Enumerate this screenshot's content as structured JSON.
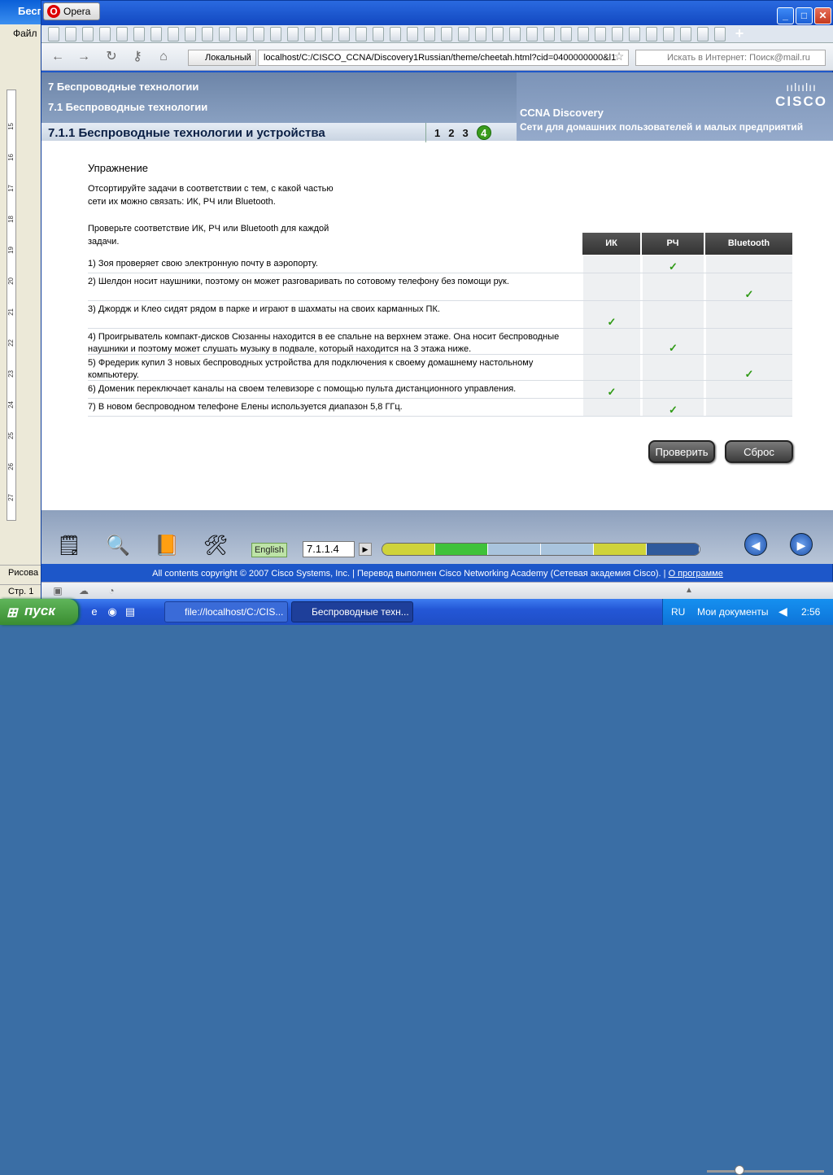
{
  "word": {
    "title": "Бесп",
    "menu_file": "Файл",
    "ruler_marks": [
      "15",
      "16",
      "17",
      "18",
      "19",
      "20",
      "21",
      "22",
      "23",
      "24",
      "25",
      "26",
      "27"
    ],
    "draw_label": "Рисова",
    "status_page": "Стр. 1"
  },
  "opera": {
    "app_label": "Opera",
    "address": {
      "location_label": "Локальный",
      "url": "localhost/C:/CISCO_CCNA/Discovery1Russian/theme/cheetah.html?cid=0400000000&l1",
      "search_placeholder": "Искать в Интернет: Поиск@mail.ru"
    }
  },
  "page": {
    "chapter": "7 Беспроводные технологии",
    "section": "7.1 Беспроводные технологии",
    "subsection": "7.1.1 Беспроводные технологии и устройства",
    "tabs": [
      "1",
      "2",
      "3",
      "4"
    ],
    "active_tab": "4",
    "brand_title": "CCNA Discovery",
    "brand_subtitle": "Сети для домашних пользователей и малых предприятий",
    "logo_text": "CISCO",
    "exercise_title": "Упражнение",
    "instruction": "Отсортируйте задачи в соответствии с тем, с какой частью сети их можно связать: ИК, РЧ или Bluetooth.",
    "check_prompt": "Проверьте соответствие ИК, РЧ или Bluetooth для каждой задачи.",
    "columns": [
      "ИК",
      "РЧ",
      "Bluetooth"
    ],
    "tasks": [
      {
        "text": "1) Зоя проверяет свою электронную почту в аэропорту.",
        "answer": "РЧ"
      },
      {
        "text": "2) Шелдон носит наушники, поэтому он может разговаривать по сотовому телефону без помощи рук.",
        "answer": "Bluetooth"
      },
      {
        "text": "3) Джордж и Клео сидят рядом в парке и играют в шахматы на своих карманных ПК.",
        "answer": "ИК"
      },
      {
        "text": "4) Проигрыватель компакт-дисков Сюзанны находится в ее спальне на верхнем этаже. Она носит беспроводные наушники и поэтому может слушать музыку в подвале, который находится на 3 этажа ниже.",
        "answer": "РЧ"
      },
      {
        "text": "5) Фредерик купил 3 новых беспроводных устройства для подключения к своему домашнему настольному компьютеру.",
        "answer": "Bluetooth"
      },
      {
        "text": "6) Доменик переключает каналы на своем телевизоре с помощью пульта дистанционного управления.",
        "answer": "ИК"
      },
      {
        "text": "7) В новом беспроводном телефоне Елены используется диапазон 5,8 ГГц.",
        "answer": "РЧ"
      }
    ],
    "check_mark": "✓",
    "check_button": "Проверить",
    "reset_button": "Сброс",
    "language_button": "English",
    "page_number": "7.1.1.4",
    "progress_segments": [
      "#cfd33a",
      "#3fc23a",
      "#a9c4dd",
      "#a9c4dd",
      "#cfd33a",
      "#2f5a9c"
    ],
    "copyright": "All contents copyright © 2007 Cisco Systems, Inc. | Перевод выполнен Cisco Networking Academy (Сетевая академия Cisco). |",
    "about_link": "О программе"
  },
  "taskbar": {
    "start_label": "пуск",
    "tasks": [
      "file://localhost/C:/CIS...",
      "Беспроводные техн..."
    ],
    "lang": "RU",
    "docs_label": "Мои документы",
    "clock": "2:56"
  }
}
